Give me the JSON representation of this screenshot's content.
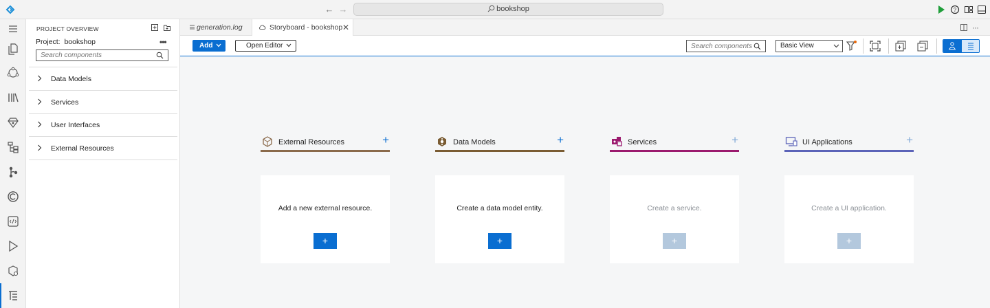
{
  "titlebar": {
    "search_text": "bookshop"
  },
  "sidebar": {
    "title": "PROJECT OVERVIEW",
    "project_label": "Project:",
    "project_name": "bookshop",
    "search_placeholder": "Search components",
    "items": [
      {
        "label": "Data Models"
      },
      {
        "label": "Services"
      },
      {
        "label": "User Interfaces"
      },
      {
        "label": "External Resources"
      }
    ]
  },
  "tabs": [
    {
      "label": "generation.log"
    },
    {
      "label": "Storyboard - bookshop"
    }
  ],
  "toolbar": {
    "add_label": "Add",
    "open_editor_label": "Open Editor",
    "search_placeholder": "Search components",
    "view_selected": "Basic View"
  },
  "columns": [
    {
      "title": "External Resources",
      "card_text": "Add a new external resource.",
      "plus": "+",
      "button_plus": "+",
      "enabled": true,
      "color": "#8a6a4b"
    },
    {
      "title": "Data Models",
      "card_text": "Create a data model entity.",
      "plus": "+",
      "button_plus": "+",
      "enabled": true,
      "color": "#7a5c33"
    },
    {
      "title": "Services",
      "card_text": "Create a service.",
      "plus": "+",
      "button_plus": "+",
      "enabled": false,
      "color": "#9b1a6e"
    },
    {
      "title": "UI Applications",
      "card_text": "Create a UI application.",
      "plus": "+",
      "button_plus": "+",
      "enabled": false,
      "color": "#5b63b8"
    }
  ],
  "colors": {
    "accent": "#0a6ed1",
    "disabled_button": "#b3c8dd",
    "disabled_text": "#8a8f95"
  }
}
